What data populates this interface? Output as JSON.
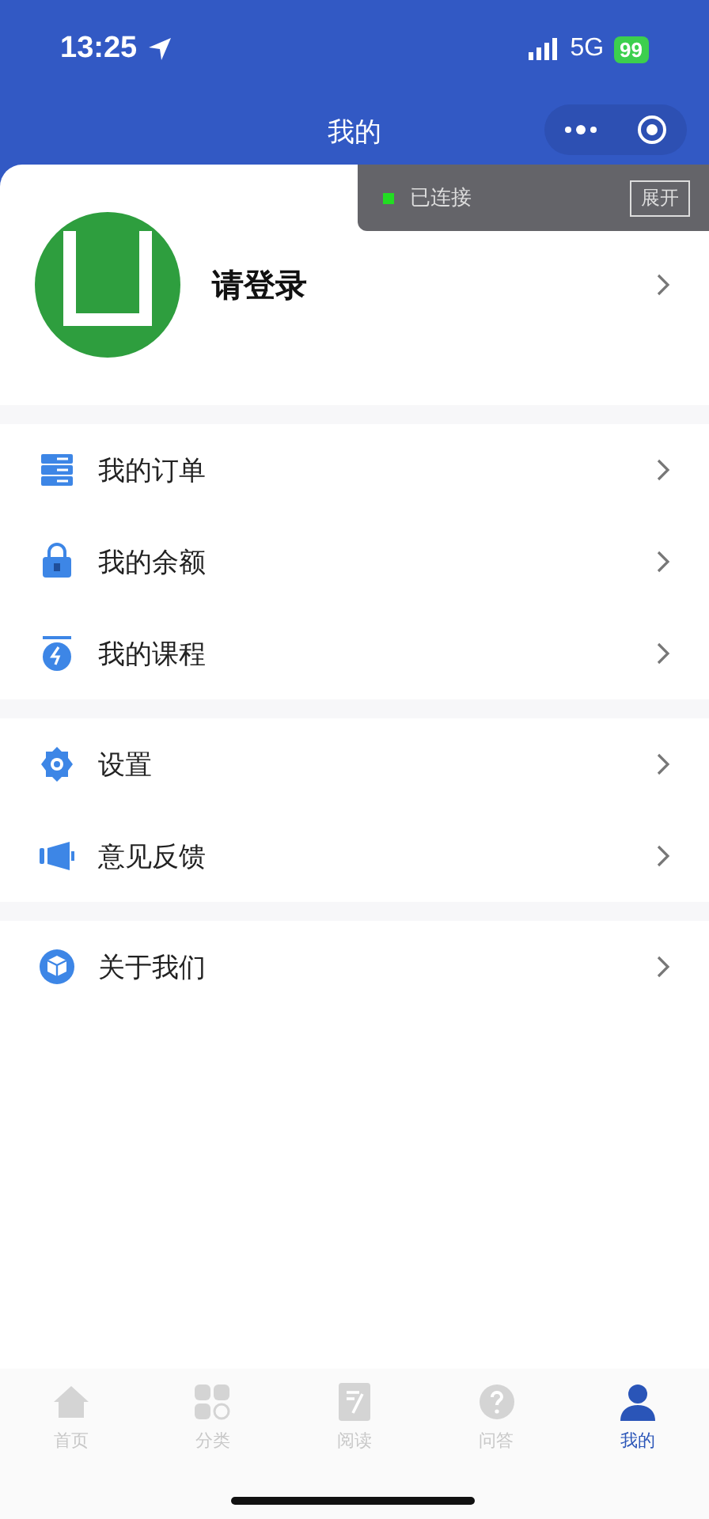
{
  "status_bar": {
    "time": "13:25",
    "network": "5G",
    "battery": "99"
  },
  "nav": {
    "title": "我的"
  },
  "debug_toast": {
    "status": "已连接",
    "color": "#22dd22",
    "button": "展开"
  },
  "profile": {
    "name": "请登录"
  },
  "menu_groups": [
    {
      "items": [
        {
          "label": "我的订单"
        },
        {
          "label": "我的余额"
        },
        {
          "label": "我的课程"
        }
      ]
    },
    {
      "items": [
        {
          "label": "设置"
        },
        {
          "label": "意见反馈"
        }
      ]
    },
    {
      "items": [
        {
          "label": "关于我们"
        }
      ]
    }
  ],
  "tab_bar": [
    {
      "label": "首页",
      "selected": false
    },
    {
      "label": "分类",
      "selected": false
    },
    {
      "label": "阅读",
      "selected": false
    },
    {
      "label": "问答",
      "selected": false
    },
    {
      "label": "我的",
      "selected": true
    }
  ]
}
